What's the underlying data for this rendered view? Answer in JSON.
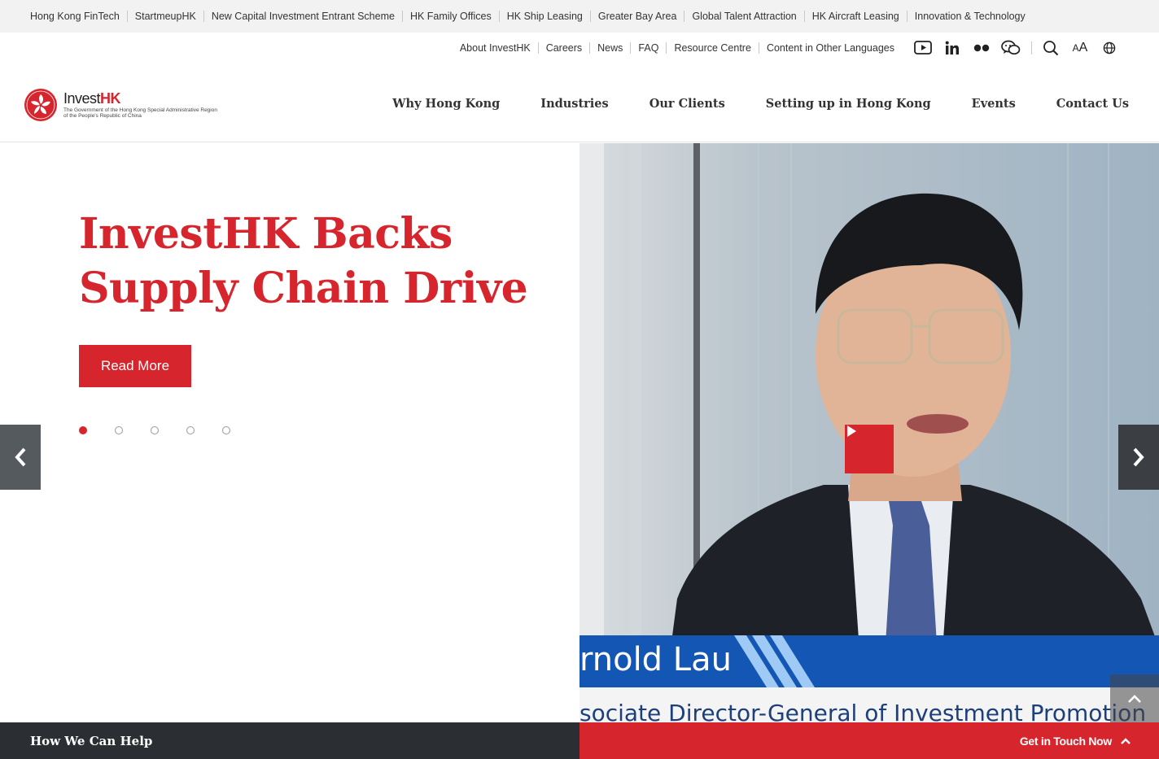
{
  "topbar": {
    "links": [
      "Hong Kong FinTech",
      "StartmeupHK",
      "New Capital Investment Entrant Scheme",
      "HK Family Offices",
      "HK Ship Leasing",
      "Greater Bay Area",
      "Global Talent Attraction",
      "HK Aircraft Leasing",
      "Innovation & Technology"
    ]
  },
  "secondary": {
    "links": [
      "About InvestHK",
      "Careers",
      "News",
      "FAQ",
      "Resource Centre",
      "Content in Other Languages"
    ],
    "icons": [
      "youtube-icon",
      "linkedin-icon",
      "flickr-icon",
      "wechat-icon",
      "search-icon",
      "font-size-icon",
      "globe-icon"
    ],
    "font_small": "A",
    "font_large": "A"
  },
  "logo": {
    "brand_prefix": "Invest",
    "brand_suffix": "HK",
    "gov_line1": "The Government of the Hong Kong Special Administrative Region",
    "gov_line2": "of the People's Republic of China"
  },
  "mainnav": [
    "Why Hong Kong",
    "Industries",
    "Our Clients",
    "Setting up in Hong Kong",
    "Events",
    "Contact Us"
  ],
  "hero": {
    "title": "InvestHK Backs Supply Chain Drive",
    "cta": "Read More",
    "slide_count": 5,
    "active_slide": 1,
    "video_name": "rnold Lau",
    "video_role": "sociate Director-General of Investment Promotion"
  },
  "bottom": {
    "help": "How We Can Help",
    "contact": "Get in Touch Now"
  },
  "colors": {
    "brand_red": "#d7252d",
    "dark_bar": "#2b2e33",
    "topbar_bg": "#f2f2f2"
  }
}
